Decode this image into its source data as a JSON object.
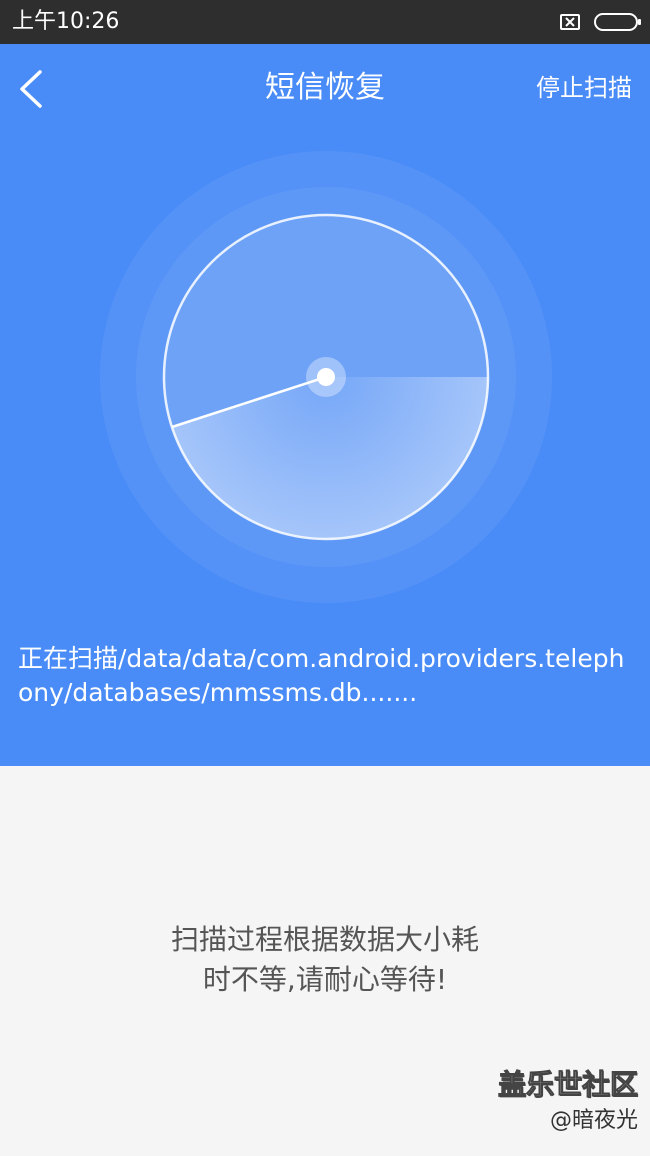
{
  "status_bar": {
    "time": "上午10:26",
    "icons": [
      "sim-icon",
      "battery-icon"
    ]
  },
  "header": {
    "back_icon": "chevron-left-icon",
    "title": "短信恢复",
    "stop_button_label": "停止扫描"
  },
  "scan": {
    "status_text": "正在扫描/data/data/com.android.providers.telephony/databases/mmssms.db.......",
    "hint": "扫描过程根据数据大小耗\n时不等,请耐心等待!"
  },
  "watermark": {
    "brand": "盖乐世社区",
    "user": "@暗夜光"
  },
  "colors": {
    "header_blue": "#4a8cf7",
    "status_bar": "#2e2e2e",
    "body_background": "#f5f5f5",
    "text_white": "#ffffff",
    "hint_gray": "#555555"
  }
}
